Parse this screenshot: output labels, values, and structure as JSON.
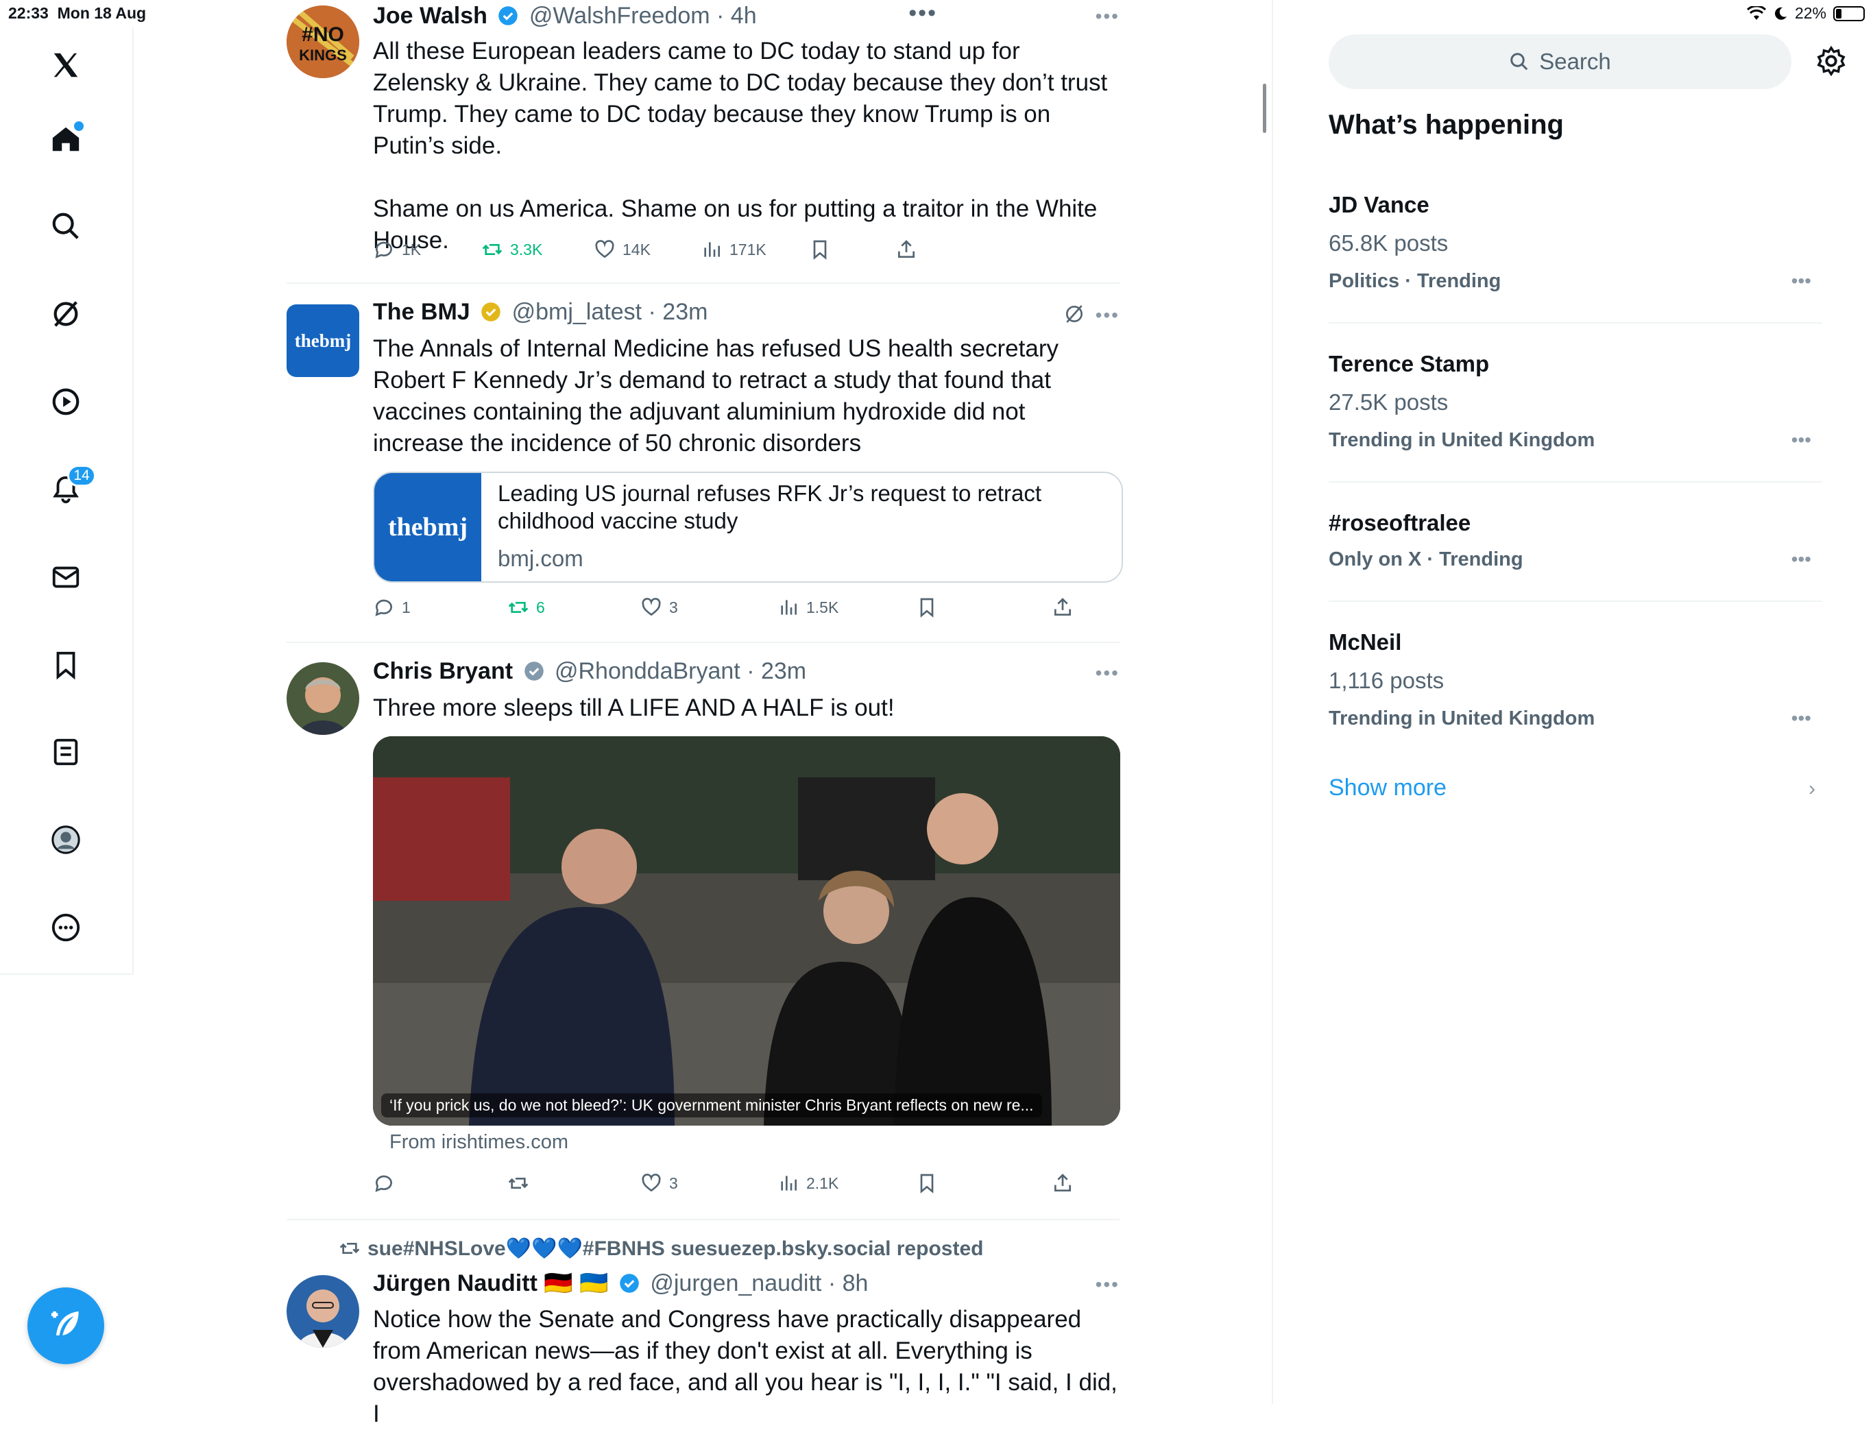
{
  "status": {
    "time": "22:33",
    "date": "Mon 18 Aug",
    "battery": "22%",
    "battery_level": 0.22
  },
  "nav": {
    "notifications_badge": "14"
  },
  "tweets": [
    {
      "name": "Joe Walsh",
      "handle": "@WalshFreedom",
      "time": "4h",
      "avatar_text": "#NO KINGS",
      "text": "All these European leaders came to DC today to stand up for Zelensky & Ukraine. They came to DC today because they don’t trust Trump. They came to DC today because they know Trump is on Putin’s side.\n\nShame on us America. Shame on us for putting a traitor in the White House.",
      "replies": "1K",
      "reposts": "3.3K",
      "likes": "14K",
      "views": "171K"
    },
    {
      "name": "The BMJ",
      "handle": "@bmj_latest",
      "time": "23m",
      "avatar_text": "thebmj",
      "text": "The Annals of Internal Medicine has refused US health secretary Robert F Kennedy Jr’s demand to retract a study that found that vaccines containing the adjuvant aluminium hydroxide did not increase the incidence of 50 chronic disorders",
      "card_logo": "thebmj",
      "card_title": "Leading US journal refuses RFK Jr’s request to retract childhood vaccine study",
      "card_domain": "bmj.com",
      "replies": "1",
      "reposts": "6",
      "likes": "3",
      "views": "1.5K"
    },
    {
      "name": "Chris Bryant",
      "handle": "@RhonddaBryant",
      "time": "23m",
      "text": "Three more sleeps till A LIFE AND A HALF is out!",
      "media_caption": "‘If you prick us, do we not bleed?’: UK government minister Chris Bryant reflects on new re...",
      "source": "From irishtimes.com",
      "replies": "",
      "reposts": "",
      "likes": "3",
      "views": "2.1K"
    },
    {
      "reposted_by": "sue#NHSLove💙💙💙#FBNHS suesuezep.bsky.social reposted",
      "name": "Jürgen Nauditt 🇩🇪 🇺🇦",
      "handle": "@jurgen_nauditt",
      "time": "8h",
      "text": "Notice how the Senate and Congress have practically disappeared from American news—as if they don't exist at all. Everything is overshadowed by a red face, and all you hear is \"I, I, I, I.\" \"I said, I did, I"
    }
  ],
  "sidebar": {
    "search_placeholder": "Search",
    "title": "What’s happening",
    "trends": [
      {
        "title": "JD Vance",
        "count": "65.8K posts",
        "category": "Politics · Trending"
      },
      {
        "title": "Terence Stamp",
        "count": "27.5K posts",
        "category": "Trending in United Kingdom"
      },
      {
        "title": "#roseoftralee",
        "count": "",
        "category": "Only on X · Trending"
      },
      {
        "title": "McNeil",
        "count": "1,116 posts",
        "category": "Trending in United Kingdom"
      }
    ],
    "show_more": "Show more"
  }
}
